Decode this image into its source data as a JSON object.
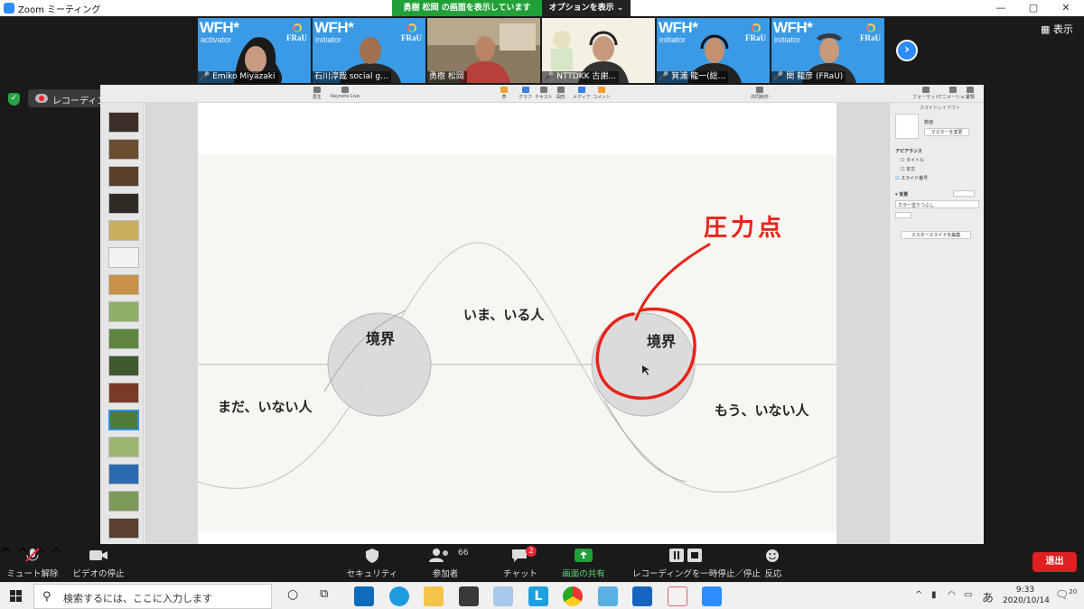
{
  "window": {
    "title": "Zoom ミーティング",
    "share_banner": "勇樹 松岡 の画面を表示しています",
    "options_button": "オプションを表示",
    "view_button": "表示"
  },
  "participants": [
    {
      "name": "Emiko Miyazaki",
      "brand": "WFH*",
      "role": "activator",
      "logo": "FRaU",
      "muted": true
    },
    {
      "name": "石川淳哉 social g...",
      "brand": "WFH*",
      "role": "initiator",
      "logo": "FRaU",
      "muted": false
    },
    {
      "name": "勇樹 松岡",
      "brand": "",
      "role": "",
      "logo": "",
      "muted": false
    },
    {
      "name": "NTTDKK 古謝...",
      "brand": "",
      "role": "",
      "logo": "",
      "muted": true
    },
    {
      "name": "箕浦 龍一(総...",
      "brand": "WFH*",
      "role": "initiator",
      "logo": "FRaU",
      "muted": true
    },
    {
      "name": "関 龍彦 (FRaU)",
      "brand": "WFH*",
      "role": "initiator",
      "logo": "FRaU",
      "muted": true
    }
  ],
  "recording": {
    "status_text": "レコーディングしています..."
  },
  "keynote": {
    "toolbar": [
      "再生",
      "Keynote Live",
      "表",
      "グラフ",
      "テキスト",
      "図形",
      "メディア",
      "コメント",
      "共同制作"
    ],
    "inspector_tabs": [
      "フォーマット",
      "アニメーション",
      "書類"
    ],
    "inspector_title": "スライドレイアウト",
    "inspector_labels": {
      "change_master": "マスターを変更",
      "master": "数値",
      "appearance": "アピアランス",
      "title": "タイトル",
      "body": "本文",
      "slide_number": "スライド番号",
      "background": "背景",
      "fill": "カラー塗りつぶし",
      "edit_master": "マスタースライドを編集"
    }
  },
  "slide": {
    "annotation": "圧力点",
    "labels": {
      "boundary_left": "境界",
      "boundary_right": "境界",
      "now": "いま、いる人",
      "not_yet": "まだ、いない人",
      "no_longer": "もう、いない人"
    }
  },
  "zoom_toolbar": {
    "mute": "ミュート解除",
    "video": "ビデオの停止",
    "security": "セキュリティ",
    "participants": "参加者",
    "participants_count": "66",
    "chat": "チャット",
    "chat_badge": "2",
    "share": "画面の共有",
    "record": "レコーディングを一時停止／停止",
    "reactions": "反応",
    "exit": "退出"
  },
  "taskbar": {
    "search_placeholder": "検索するには、ここに入力します",
    "time": "9:33",
    "date": "2020/10/14",
    "ime": "あ",
    "notifications": "20"
  },
  "colors": {
    "share_green": "#21a038",
    "zoom_blue": "#2d8cff",
    "exit_red": "#e02020",
    "annotation_red": "#e8231a",
    "tile_blue": "#3a9ae6"
  }
}
